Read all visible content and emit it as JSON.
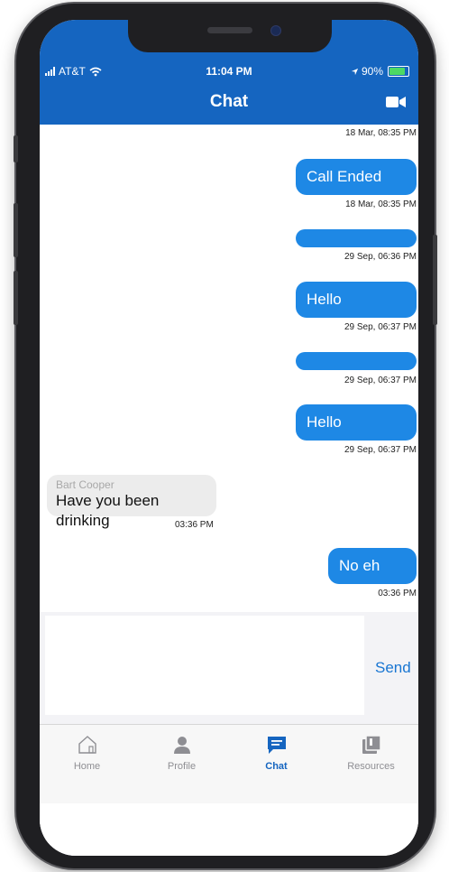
{
  "status_bar": {
    "carrier": "AT&T",
    "time": "11:04 PM",
    "battery": "90%"
  },
  "header": {
    "title": "Chat"
  },
  "messages": [
    {
      "direction": "out",
      "text": "",
      "timestamp": "18 Mar, 08:35 PM"
    },
    {
      "direction": "out",
      "text": "Call Ended",
      "timestamp": "18 Mar, 08:35 PM"
    },
    {
      "direction": "out",
      "text": "",
      "timestamp": "29 Sep, 06:36 PM"
    },
    {
      "direction": "out",
      "text": "Hello",
      "timestamp": "29 Sep, 06:37 PM"
    },
    {
      "direction": "out",
      "text": "",
      "timestamp": "29 Sep, 06:37 PM"
    },
    {
      "direction": "out",
      "text": "Hello",
      "timestamp": "29 Sep, 06:37 PM"
    },
    {
      "direction": "in",
      "sender": "Bart Cooper",
      "text": "Have you been drinking",
      "timestamp": "03:36 PM"
    },
    {
      "direction": "out",
      "text": "No eh",
      "timestamp": "03:36 PM"
    }
  ],
  "composer": {
    "value": "",
    "placeholder": "",
    "send_label": "Send"
  },
  "tabs": [
    {
      "label": "Home",
      "icon": "home-icon",
      "active": false
    },
    {
      "label": "Profile",
      "icon": "person-icon",
      "active": false
    },
    {
      "label": "Chat",
      "icon": "chat-icon",
      "active": true
    },
    {
      "label": "Resources",
      "icon": "resources-icon",
      "active": false
    }
  ],
  "colors": {
    "header": "#1565c0",
    "bubble_out": "#1e88e5",
    "bubble_in": "#ececec",
    "active_tab": "#1565c0",
    "inactive_tab": "#8e8e93"
  }
}
